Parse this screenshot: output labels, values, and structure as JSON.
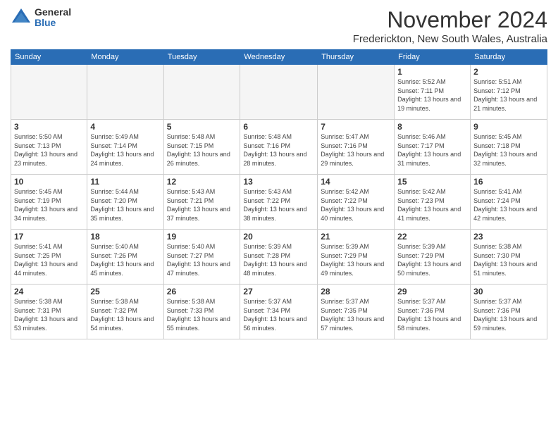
{
  "logo": {
    "general": "General",
    "blue": "Blue"
  },
  "header": {
    "title": "November 2024",
    "subtitle": "Frederickton, New South Wales, Australia"
  },
  "weekdays": [
    "Sunday",
    "Monday",
    "Tuesday",
    "Wednesday",
    "Thursday",
    "Friday",
    "Saturday"
  ],
  "weeks": [
    [
      {
        "day": "",
        "sunrise": "",
        "sunset": "",
        "daylight": ""
      },
      {
        "day": "",
        "sunrise": "",
        "sunset": "",
        "daylight": ""
      },
      {
        "day": "",
        "sunrise": "",
        "sunset": "",
        "daylight": ""
      },
      {
        "day": "",
        "sunrise": "",
        "sunset": "",
        "daylight": ""
      },
      {
        "day": "",
        "sunrise": "",
        "sunset": "",
        "daylight": ""
      },
      {
        "day": "1",
        "sunrise": "Sunrise: 5:52 AM",
        "sunset": "Sunset: 7:11 PM",
        "daylight": "Daylight: 13 hours and 19 minutes."
      },
      {
        "day": "2",
        "sunrise": "Sunrise: 5:51 AM",
        "sunset": "Sunset: 7:12 PM",
        "daylight": "Daylight: 13 hours and 21 minutes."
      }
    ],
    [
      {
        "day": "3",
        "sunrise": "Sunrise: 5:50 AM",
        "sunset": "Sunset: 7:13 PM",
        "daylight": "Daylight: 13 hours and 23 minutes."
      },
      {
        "day": "4",
        "sunrise": "Sunrise: 5:49 AM",
        "sunset": "Sunset: 7:14 PM",
        "daylight": "Daylight: 13 hours and 24 minutes."
      },
      {
        "day": "5",
        "sunrise": "Sunrise: 5:48 AM",
        "sunset": "Sunset: 7:15 PM",
        "daylight": "Daylight: 13 hours and 26 minutes."
      },
      {
        "day": "6",
        "sunrise": "Sunrise: 5:48 AM",
        "sunset": "Sunset: 7:16 PM",
        "daylight": "Daylight: 13 hours and 28 minutes."
      },
      {
        "day": "7",
        "sunrise": "Sunrise: 5:47 AM",
        "sunset": "Sunset: 7:16 PM",
        "daylight": "Daylight: 13 hours and 29 minutes."
      },
      {
        "day": "8",
        "sunrise": "Sunrise: 5:46 AM",
        "sunset": "Sunset: 7:17 PM",
        "daylight": "Daylight: 13 hours and 31 minutes."
      },
      {
        "day": "9",
        "sunrise": "Sunrise: 5:45 AM",
        "sunset": "Sunset: 7:18 PM",
        "daylight": "Daylight: 13 hours and 32 minutes."
      }
    ],
    [
      {
        "day": "10",
        "sunrise": "Sunrise: 5:45 AM",
        "sunset": "Sunset: 7:19 PM",
        "daylight": "Daylight: 13 hours and 34 minutes."
      },
      {
        "day": "11",
        "sunrise": "Sunrise: 5:44 AM",
        "sunset": "Sunset: 7:20 PM",
        "daylight": "Daylight: 13 hours and 35 minutes."
      },
      {
        "day": "12",
        "sunrise": "Sunrise: 5:43 AM",
        "sunset": "Sunset: 7:21 PM",
        "daylight": "Daylight: 13 hours and 37 minutes."
      },
      {
        "day": "13",
        "sunrise": "Sunrise: 5:43 AM",
        "sunset": "Sunset: 7:22 PM",
        "daylight": "Daylight: 13 hours and 38 minutes."
      },
      {
        "day": "14",
        "sunrise": "Sunrise: 5:42 AM",
        "sunset": "Sunset: 7:22 PM",
        "daylight": "Daylight: 13 hours and 40 minutes."
      },
      {
        "day": "15",
        "sunrise": "Sunrise: 5:42 AM",
        "sunset": "Sunset: 7:23 PM",
        "daylight": "Daylight: 13 hours and 41 minutes."
      },
      {
        "day": "16",
        "sunrise": "Sunrise: 5:41 AM",
        "sunset": "Sunset: 7:24 PM",
        "daylight": "Daylight: 13 hours and 42 minutes."
      }
    ],
    [
      {
        "day": "17",
        "sunrise": "Sunrise: 5:41 AM",
        "sunset": "Sunset: 7:25 PM",
        "daylight": "Daylight: 13 hours and 44 minutes."
      },
      {
        "day": "18",
        "sunrise": "Sunrise: 5:40 AM",
        "sunset": "Sunset: 7:26 PM",
        "daylight": "Daylight: 13 hours and 45 minutes."
      },
      {
        "day": "19",
        "sunrise": "Sunrise: 5:40 AM",
        "sunset": "Sunset: 7:27 PM",
        "daylight": "Daylight: 13 hours and 47 minutes."
      },
      {
        "day": "20",
        "sunrise": "Sunrise: 5:39 AM",
        "sunset": "Sunset: 7:28 PM",
        "daylight": "Daylight: 13 hours and 48 minutes."
      },
      {
        "day": "21",
        "sunrise": "Sunrise: 5:39 AM",
        "sunset": "Sunset: 7:29 PM",
        "daylight": "Daylight: 13 hours and 49 minutes."
      },
      {
        "day": "22",
        "sunrise": "Sunrise: 5:39 AM",
        "sunset": "Sunset: 7:29 PM",
        "daylight": "Daylight: 13 hours and 50 minutes."
      },
      {
        "day": "23",
        "sunrise": "Sunrise: 5:38 AM",
        "sunset": "Sunset: 7:30 PM",
        "daylight": "Daylight: 13 hours and 51 minutes."
      }
    ],
    [
      {
        "day": "24",
        "sunrise": "Sunrise: 5:38 AM",
        "sunset": "Sunset: 7:31 PM",
        "daylight": "Daylight: 13 hours and 53 minutes."
      },
      {
        "day": "25",
        "sunrise": "Sunrise: 5:38 AM",
        "sunset": "Sunset: 7:32 PM",
        "daylight": "Daylight: 13 hours and 54 minutes."
      },
      {
        "day": "26",
        "sunrise": "Sunrise: 5:38 AM",
        "sunset": "Sunset: 7:33 PM",
        "daylight": "Daylight: 13 hours and 55 minutes."
      },
      {
        "day": "27",
        "sunrise": "Sunrise: 5:37 AM",
        "sunset": "Sunset: 7:34 PM",
        "daylight": "Daylight: 13 hours and 56 minutes."
      },
      {
        "day": "28",
        "sunrise": "Sunrise: 5:37 AM",
        "sunset": "Sunset: 7:35 PM",
        "daylight": "Daylight: 13 hours and 57 minutes."
      },
      {
        "day": "29",
        "sunrise": "Sunrise: 5:37 AM",
        "sunset": "Sunset: 7:36 PM",
        "daylight": "Daylight: 13 hours and 58 minutes."
      },
      {
        "day": "30",
        "sunrise": "Sunrise: 5:37 AM",
        "sunset": "Sunset: 7:36 PM",
        "daylight": "Daylight: 13 hours and 59 minutes."
      }
    ]
  ]
}
